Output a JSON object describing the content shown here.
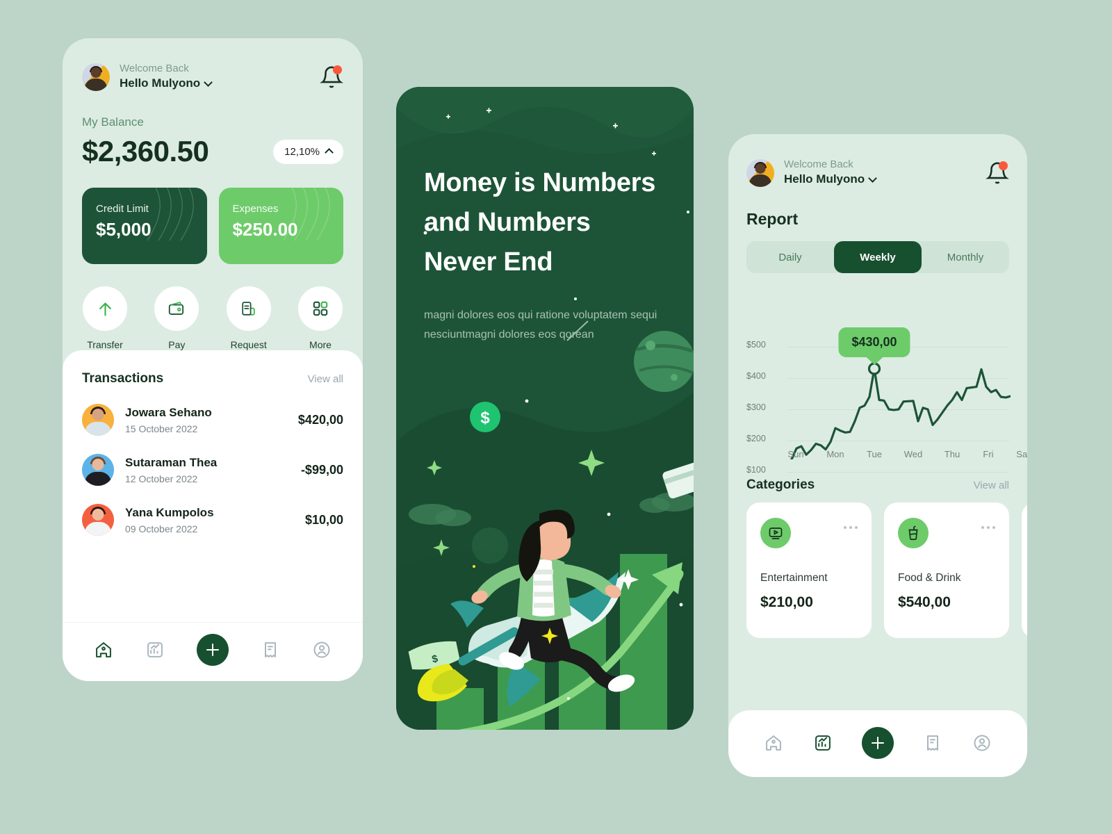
{
  "header": {
    "welcome": "Welcome Back",
    "username": "Hello Mulyono",
    "chevron_icon": "chevron-down-icon",
    "bell_icon": "bell-icon"
  },
  "balance": {
    "label": "My Balance",
    "amount": "$2,360.50",
    "change": "12,10%",
    "change_icon": "chevron-up-icon"
  },
  "stat_cards": [
    {
      "label": "Credit Limit",
      "value": "$5,000",
      "color": "#1d5437"
    },
    {
      "label": "Expenses",
      "value": "$250.00",
      "color": "#6ecb6a"
    }
  ],
  "quick_actions": [
    {
      "label": "Transfer",
      "icon": "arrow-up-icon"
    },
    {
      "label": "Pay",
      "icon": "wallet-icon"
    },
    {
      "label": "Request",
      "icon": "document-icon"
    },
    {
      "label": "More",
      "icon": "grid-icon"
    }
  ],
  "transactions": {
    "title": "Transactions",
    "view_all": "View all",
    "items": [
      {
        "name": "Jowara Sehano",
        "date": "15 October 2022",
        "amount": "$420,00",
        "avatar_color": "#f8b13c"
      },
      {
        "name": "Sutaraman Thea",
        "date": "12 October 2022",
        "amount": "-$99,00",
        "avatar_color": "#5cb3e8"
      },
      {
        "name": "Yana Kumpolos",
        "date": "09 October 2022",
        "amount": "$10,00",
        "avatar_color": "#f4603f"
      }
    ]
  },
  "bottom_nav": {
    "items": [
      {
        "icon": "home-icon",
        "active_left": true,
        "active_right": false
      },
      {
        "icon": "chart-icon",
        "active_left": false,
        "active_right": true
      },
      {
        "icon": "plus-icon",
        "fab": true
      },
      {
        "icon": "receipt-icon",
        "active_left": false,
        "active_right": false
      },
      {
        "icon": "profile-icon",
        "active_left": false,
        "active_right": false
      }
    ]
  },
  "hero": {
    "heading_lines": [
      "Money is Numbers",
      "and Numbers",
      "Never End"
    ],
    "paragraph": "magni dolores eos qui ratione voluptatem sequi nesciuntmagni dolores eos qorean"
  },
  "report": {
    "title": "Report",
    "tabs": [
      {
        "label": "Daily",
        "selected": false
      },
      {
        "label": "Weekly",
        "selected": true
      },
      {
        "label": "Monthly",
        "selected": false
      }
    ]
  },
  "categories": {
    "title": "Categories",
    "view_all": "View all",
    "items": [
      {
        "name": "Entertainment",
        "amount": "$210,00",
        "icon": "video-player-icon",
        "menu_icon": "more-dots-icon"
      },
      {
        "name": "Food & Drink",
        "amount": "$540,00",
        "icon": "drink-cup-icon",
        "menu_icon": "more-dots-icon"
      }
    ]
  },
  "chart_data": {
    "type": "line",
    "title": "Report",
    "xlabel": "",
    "ylabel": "",
    "ylim": [
      100,
      500
    ],
    "yticks": [
      "$100",
      "$200",
      "$300",
      "$400",
      "$500"
    ],
    "categories": [
      "Sun",
      "Mon",
      "Tue",
      "Wed",
      "Thu",
      "Fri",
      "Sat"
    ],
    "grid": true,
    "legend": "none",
    "line_color": "#1d5437",
    "highlight": {
      "label": "$430,00",
      "value": 430,
      "x_position": 0.42
    },
    "values": [
      125,
      140,
      175,
      182,
      155,
      170,
      190,
      185,
      172,
      196,
      240,
      232,
      226,
      228,
      262,
      305,
      312,
      340,
      430,
      330,
      328,
      300,
      298,
      300,
      325,
      326,
      327,
      262,
      305,
      300,
      250,
      268,
      290,
      312,
      330,
      355,
      330,
      368,
      370,
      372,
      428,
      372,
      355,
      362,
      340,
      338,
      342
    ]
  }
}
